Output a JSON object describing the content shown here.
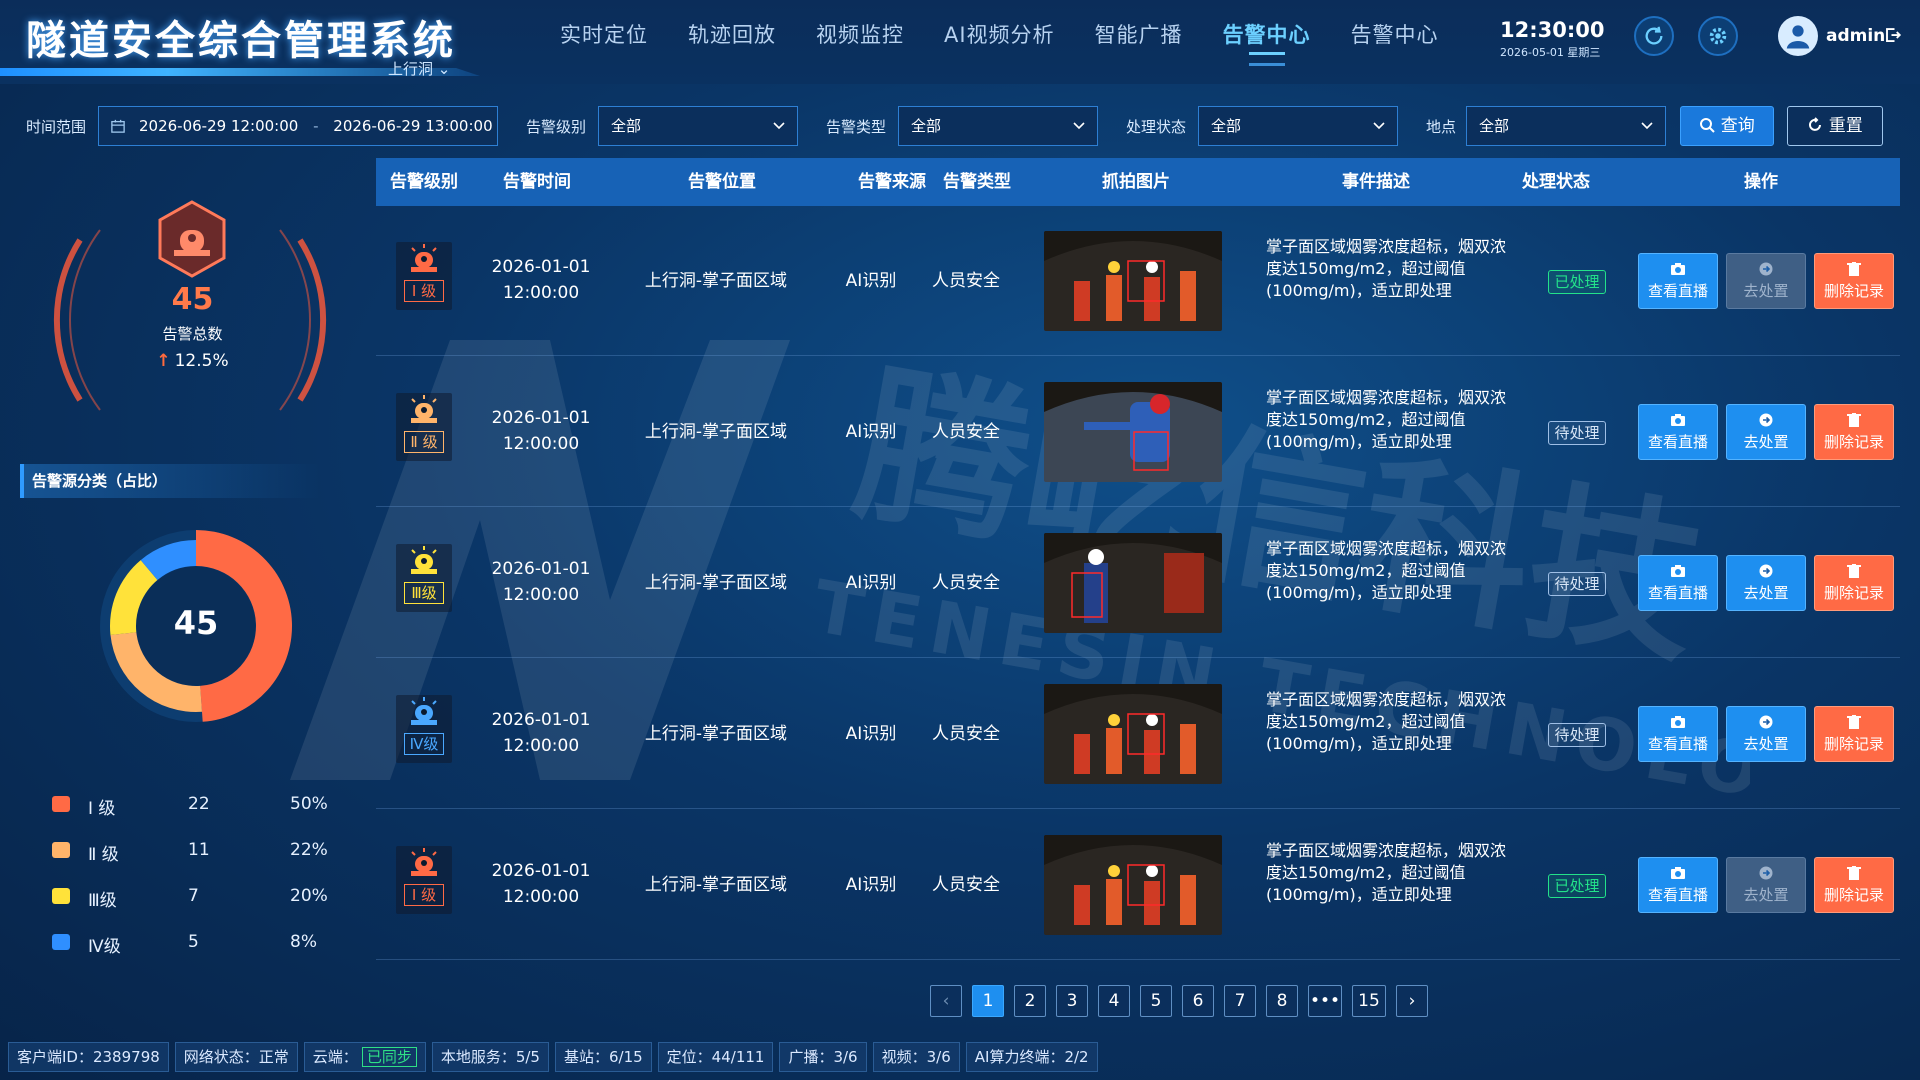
{
  "header": {
    "title": "隧道安全综合管理系统",
    "branch": "上行洞",
    "nav": [
      "实时定位",
      "轨迹回放",
      "视频监控",
      "AI视频分析",
      "智能广播",
      "告警中心",
      "告警中心"
    ],
    "active_nav": 5,
    "time": "12:30:00",
    "date": "2026-05-01  星期三",
    "user": "admin"
  },
  "filters": {
    "time_label": "时间范围",
    "time_start": "2026-06-29 12:00:00",
    "time_sep": "-",
    "time_end": "2026-06-29 13:00:00",
    "level_label": "告警级别",
    "level_value": "全部",
    "type_label": "告警类型",
    "type_value": "全部",
    "state_label": "处理状态",
    "state_value": "全部",
    "place_label": "地点",
    "place_value": "全部",
    "query": "查询",
    "reset": "重置"
  },
  "summary": {
    "total": "45",
    "total_label": "告警总数",
    "trend": "12.5%",
    "section_title": "告警源分类（占比）",
    "donut_total": "45",
    "legend": [
      {
        "name": "Ⅰ 级",
        "count": "22",
        "pct": "50%",
        "color": "#ff6a45"
      },
      {
        "name": "Ⅱ 级",
        "count": "11",
        "pct": "22%",
        "color": "#ffb46a"
      },
      {
        "name": "Ⅲ级",
        "count": "7",
        "pct": "20%",
        "color": "#ffe23a"
      },
      {
        "name": "Ⅳ级",
        "count": "5",
        "pct": "8%",
        "color": "#2f8fff"
      }
    ]
  },
  "chart_data": {
    "type": "pie",
    "categories": [
      "Ⅰ 级",
      "Ⅱ 级",
      "Ⅲ级",
      "Ⅳ级"
    ],
    "values": [
      22,
      11,
      7,
      5
    ]
  },
  "table": {
    "columns": [
      "告警级别",
      "告警时间",
      "告警位置",
      "告警来源",
      "告警类型",
      "抓拍图片",
      "事件描述",
      "处理状态",
      "操作"
    ],
    "rows": [
      {
        "level": "Ⅰ 级",
        "level_color": "#ff6a45",
        "date": "2026-01-01",
        "time": "12:00:00",
        "location": "上行洞-掌子面区域",
        "source": "AI识别",
        "type": "人员安全",
        "desc": "掌子面区域烟雾浓度超标，烟双浓度达150mg/m2，超过阈值(100mg/m)，适立即处理",
        "status": "已处理",
        "status_kind": "done",
        "live": "查看直播",
        "handle": "去处置",
        "handle_enabled": false,
        "delete": "删除记录"
      },
      {
        "level": "Ⅱ 级",
        "level_color": "#ffb46a",
        "date": "2026-01-01",
        "time": "12:00:00",
        "location": "上行洞-掌子面区域",
        "source": "AI识别",
        "type": "人员安全",
        "desc": "掌子面区域烟雾浓度超标，烟双浓度达150mg/m2，超过阈值(100mg/m)，适立即处理",
        "status": "待处理",
        "status_kind": "todo",
        "live": "查看直播",
        "handle": "去处置",
        "handle_enabled": true,
        "delete": "删除记录"
      },
      {
        "level": "Ⅲ级",
        "level_color": "#ffe23a",
        "date": "2026-01-01",
        "time": "12:00:00",
        "location": "上行洞-掌子面区域",
        "source": "AI识别",
        "type": "人员安全",
        "desc": "掌子面区域烟雾浓度超标，烟双浓度达150mg/m2，超过阈值(100mg/m)，适立即处理",
        "status": "待处理",
        "status_kind": "todo",
        "live": "查看直播",
        "handle": "去处置",
        "handle_enabled": true,
        "delete": "删除记录"
      },
      {
        "level": "Ⅳ级",
        "level_color": "#4aa8ff",
        "date": "2026-01-01",
        "time": "12:00:00",
        "location": "上行洞-掌子面区域",
        "source": "AI识别",
        "type": "人员安全",
        "desc": "掌子面区域烟雾浓度超标，烟双浓度达150mg/m2，超过阈值(100mg/m)，适立即处理",
        "status": "待处理",
        "status_kind": "todo",
        "live": "查看直播",
        "handle": "去处置",
        "handle_enabled": true,
        "delete": "删除记录"
      },
      {
        "level": "Ⅰ 级",
        "level_color": "#ff6a45",
        "date": "2026-01-01",
        "time": "12:00:00",
        "location": "上行洞-掌子面区域",
        "source": "AI识别",
        "type": "人员安全",
        "desc": "掌子面区域烟雾浓度超标，烟双浓度达150mg/m2，超过阈值(100mg/m)，适立即处理",
        "status": "已处理",
        "status_kind": "done",
        "live": "查看直播",
        "handle": "去处置",
        "handle_enabled": false,
        "delete": "删除记录"
      }
    ]
  },
  "pagination": {
    "pages": [
      "1",
      "2",
      "3",
      "4",
      "5",
      "6",
      "7",
      "8"
    ],
    "ellipsis": "•••",
    "last": "15",
    "current": "1"
  },
  "statusbar": {
    "client": "客户端ID：2389798",
    "network": "网络状态：正常",
    "cloud_label": "云端：",
    "cloud_state": "已同步",
    "local": "本地服务：5/5",
    "station": "基站：6/15",
    "locate": "定位：44/111",
    "broadcast": "广播：3/6",
    "video": "视频：3/6",
    "ai": "AI算力终端：2/2"
  },
  "watermark": {
    "brand": "腾屹信科技",
    "brand_en": "TENESIN TECHNOLOGY"
  }
}
